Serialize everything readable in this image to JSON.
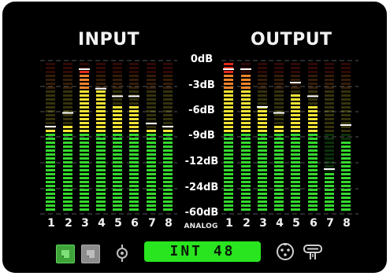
{
  "headers": {
    "input": "INPUT",
    "output": "OUTPUT"
  },
  "db_scale": [
    "0dB",
    "-3dB",
    "-6dB",
    "-9dB",
    "-12dB",
    "-24dB",
    "-60dB"
  ],
  "analog_label": "ANALOG",
  "input_channels": [
    {
      "label": "1",
      "level": 0.56,
      "peak": 0.57
    },
    {
      "label": "2",
      "level": 0.58,
      "peak": 0.66
    },
    {
      "label": "3",
      "level": 0.94,
      "peak": 0.98
    },
    {
      "label": "4",
      "level": 0.81,
      "peak": 0.82
    },
    {
      "label": "5",
      "level": 0.7,
      "peak": 0.77
    },
    {
      "label": "6",
      "level": 0.7,
      "peak": 0.77
    },
    {
      "label": "7",
      "level": 0.55,
      "peak": 0.59
    },
    {
      "label": "8",
      "level": 0.55,
      "peak": 0.57
    }
  ],
  "output_channels": [
    {
      "label": "1",
      "level": 0.99,
      "peak": 1.02
    },
    {
      "label": "2",
      "level": 0.93,
      "peak": 0.96
    },
    {
      "label": "3",
      "level": 0.7,
      "peak": 0.7
    },
    {
      "label": "4",
      "level": 0.57,
      "peak": 0.66
    },
    {
      "label": "5",
      "level": 0.8,
      "peak": 0.86
    },
    {
      "label": "6",
      "level": 0.72,
      "peak": 0.77
    },
    {
      "label": "7",
      "level": 0.25,
      "peak": 0.29
    },
    {
      "label": "8",
      "level": 0.48,
      "peak": 0.58
    }
  ],
  "bottom_bar": {
    "sync_label": "INT 48",
    "icons": [
      "input-select-icon",
      "output-select-icon",
      "digital-input-icon",
      "xlr-connector-icon",
      "phantom-power-icon"
    ]
  },
  "colors": {
    "meter_green": "#35d92e",
    "meter_yellow": "#f2e436",
    "meter_orange": "#f0842a",
    "meter_red": "#e02a1c",
    "sync_green": "#29e51f",
    "btn_green": "#3ea43a",
    "btn_grey": "#8c8c8c"
  }
}
